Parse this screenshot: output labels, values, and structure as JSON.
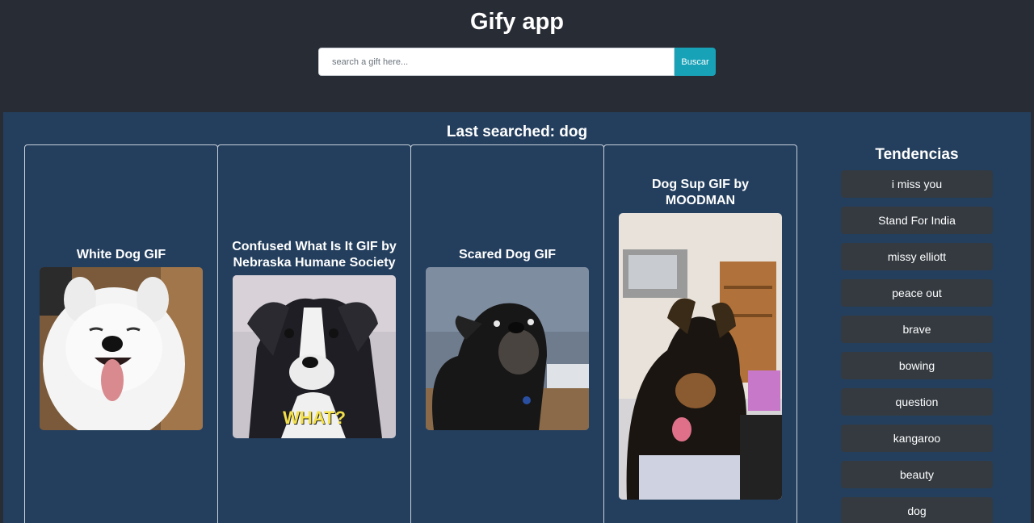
{
  "header": {
    "title": "Gify app",
    "search": {
      "placeholder": "search a gift here...",
      "value": "",
      "button_label": "Buscar"
    }
  },
  "main": {
    "last_searched": "Last searched: dog",
    "gifs": [
      {
        "title": "White Dog GIF",
        "image": "white-fluffy-dog"
      },
      {
        "title": "Confused What Is It GIF by Nebraska Humane Society",
        "image": "confused-dog",
        "caption": "WHAT?"
      },
      {
        "title": "Scared Dog GIF",
        "image": "scared-black-dog"
      },
      {
        "title": "Dog Sup GIF by MOODMAN",
        "image": "puppy"
      }
    ]
  },
  "sidebar": {
    "title": "Tendencias",
    "items": [
      {
        "label": "i miss you"
      },
      {
        "label": "Stand For India"
      },
      {
        "label": "missy elliott"
      },
      {
        "label": "peace out"
      },
      {
        "label": "brave"
      },
      {
        "label": "bowing"
      },
      {
        "label": "question"
      },
      {
        "label": "kangaroo"
      },
      {
        "label": "beauty"
      },
      {
        "label": "dog"
      }
    ]
  },
  "colors": {
    "header_bg": "#282c34",
    "main_bg": "#243f5e",
    "accent": "#17a2b8",
    "trend_bg": "#343a40"
  }
}
